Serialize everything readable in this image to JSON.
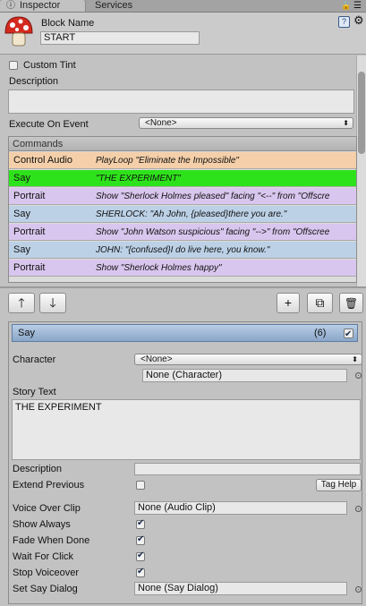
{
  "tabs": {
    "inspector": "Inspector",
    "services": "Services"
  },
  "header": {
    "block_name_label": "Block Name",
    "block_name_value": "START"
  },
  "properties": {
    "custom_tint": "Custom Tint",
    "description": "Description",
    "execute_on_event": "Execute On Event",
    "execute_on_event_value": "<None>"
  },
  "commands": {
    "header": "Commands",
    "rows": [
      {
        "name": "Control Audio",
        "summary": "PlayLoop \"Eliminate the Impossible\"",
        "color": "#f4cfa9"
      },
      {
        "name": "Say",
        "summary": "\"THE EXPERIMENT\"",
        "color": "#2ee21b"
      },
      {
        "name": "Portrait",
        "summary": "Show \"Sherlock Holmes pleased\" facing \"<--\" from \"Offscre",
        "color": "#d9c6ee"
      },
      {
        "name": "Say",
        "summary": "SHERLOCK: \"Ah John, {pleased}there you are.\"",
        "color": "#bcd1e6"
      },
      {
        "name": "Portrait",
        "summary": "Show \"John Watson suspicious\" facing \"-->\" from \"Offscree",
        "color": "#d9c6ee"
      },
      {
        "name": "Say",
        "summary": "JOHN: \"{confused}I do live here, you know.\"",
        "color": "#bcd1e6"
      },
      {
        "name": "Portrait",
        "summary": "Show \"Sherlock Holmes happy\"",
        "color": "#d9c6ee"
      }
    ]
  },
  "toolbar": {
    "up": "🡑",
    "down": "🡓",
    "add": "+",
    "duplicate": "⧉",
    "delete": "🗑"
  },
  "say_command": {
    "title": "Say",
    "index": "(6)",
    "character_label": "Character",
    "character_popup": "<None>",
    "character_object": "None (Character)",
    "story_text_label": "Story Text",
    "story_text": "THE EXPERIMENT",
    "description_label": "Description",
    "description_value": "",
    "extend_previous": "Extend Previous",
    "tag_help": "Tag Help",
    "voice_over_clip": "Voice Over Clip",
    "voice_over_clip_value": "None (Audio Clip)",
    "show_always": "Show Always",
    "fade_when_done": "Fade When Done",
    "wait_for_click": "Wait For Click",
    "stop_voiceover": "Stop Voiceover",
    "set_say_dialog": "Set Say Dialog",
    "set_say_dialog_value": "None (Say Dialog)"
  }
}
